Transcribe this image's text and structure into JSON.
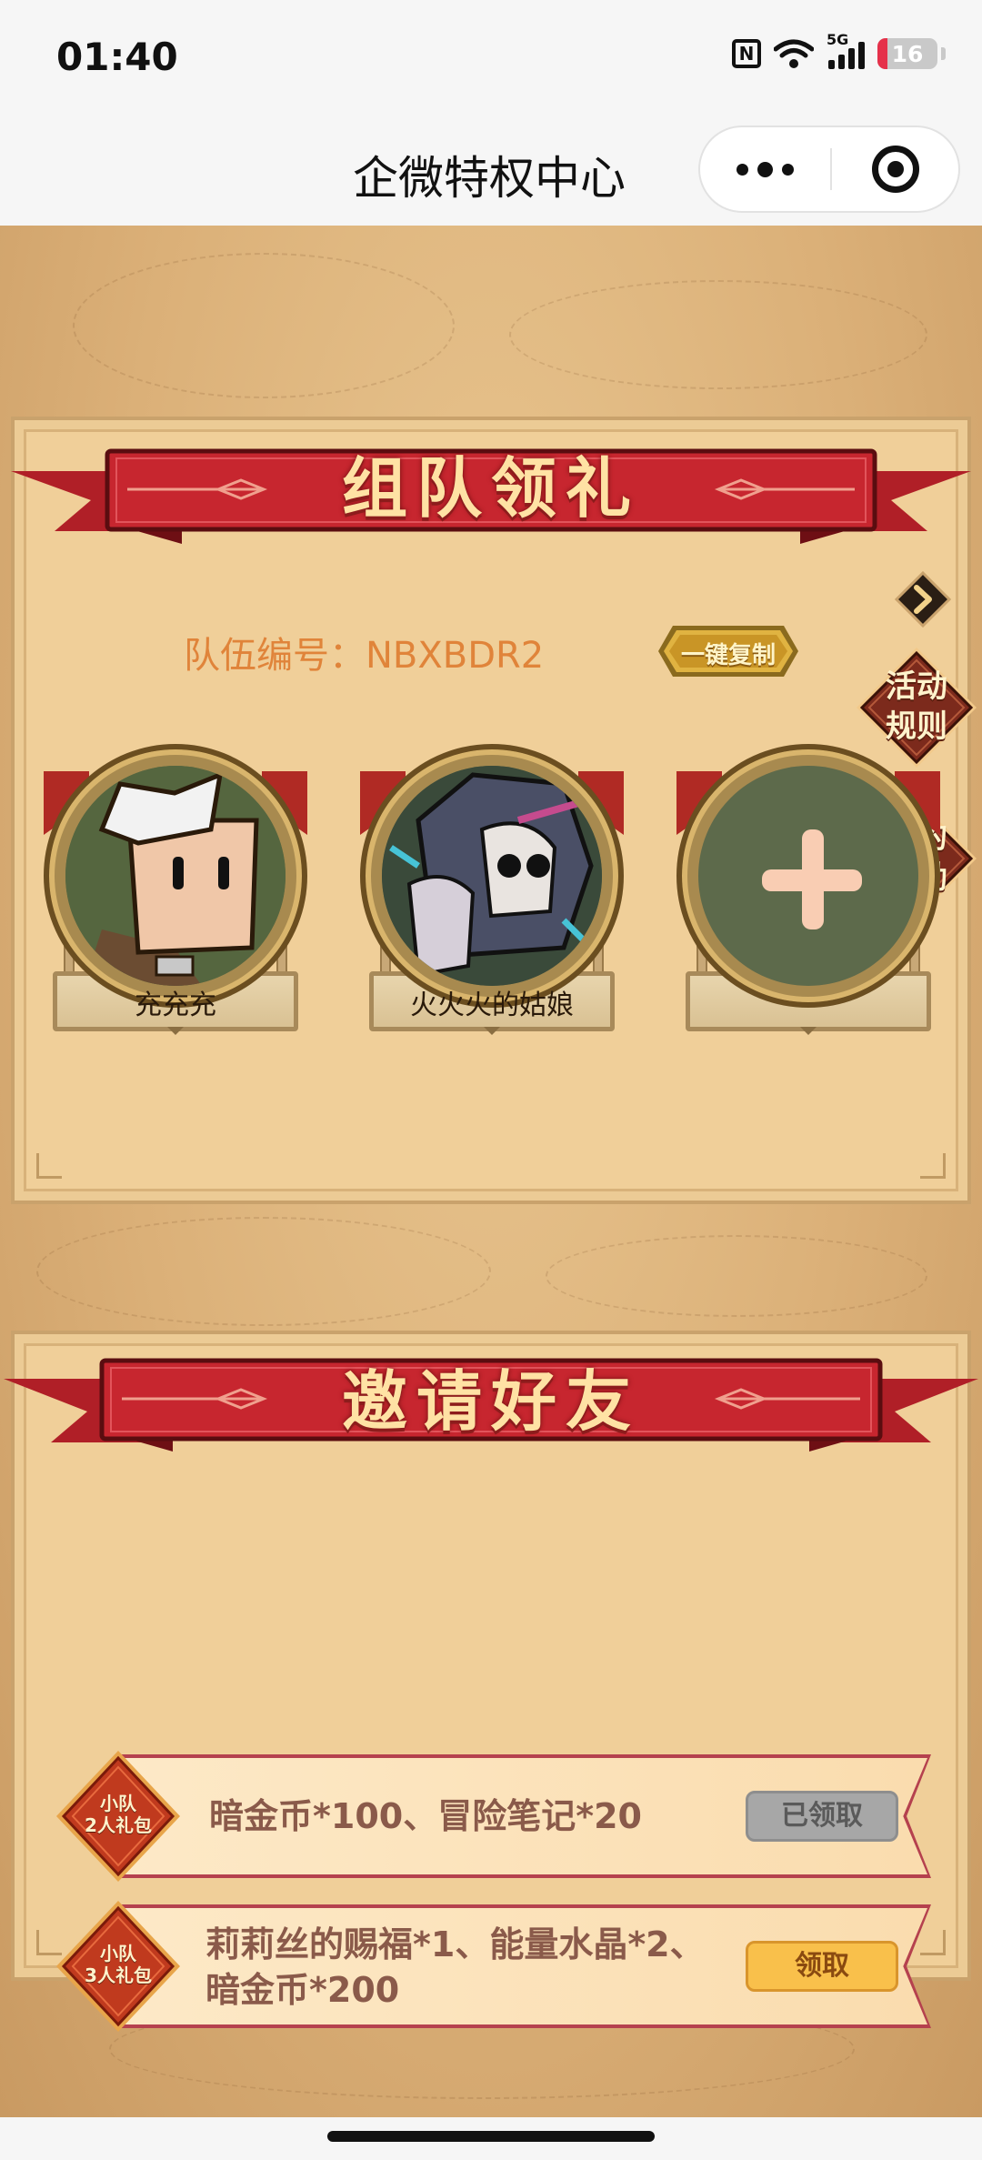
{
  "status_bar": {
    "time": "01:40",
    "network": "5G",
    "battery": "16",
    "battery_fraction": 0.16,
    "icons": [
      "nfc-icon",
      "wifi-icon",
      "signal-icon",
      "battery-icon"
    ]
  },
  "nav": {
    "title": "企微特权中心",
    "more_icon": "more-dots-icon",
    "close_icon": "close-miniprogram-icon"
  },
  "team": {
    "section_title": "组队领礼",
    "team_id_label": "队伍编号：NBXBDR2",
    "copy_label": "一键复制",
    "rules_label": [
      "活动",
      "规则"
    ],
    "rewards_label": [
      "我的",
      "奖励"
    ],
    "members": [
      {
        "name": "充充充"
      },
      {
        "name": "火火火的姑娘"
      },
      {
        "name": ""
      }
    ]
  },
  "invite": {
    "section_title": "邀请好友",
    "rewards": [
      {
        "badge": [
          "小队",
          "2人礼包"
        ],
        "desc": [
          "暗金币*100、冒险笔记*20"
        ],
        "button": "已领取",
        "state": "claimed"
      },
      {
        "badge": [
          "小队",
          "3人礼包"
        ],
        "desc": [
          "莉莉丝的赐福*1、能量水晶*2、",
          "暗金币*200"
        ],
        "button": "领取",
        "state": "available"
      }
    ]
  },
  "colors": {
    "ribbon_red": "#c7262f",
    "parchment": "#f0cf99",
    "team_id_orange": "#e0843a",
    "claim_yellow": "#f9c04b",
    "claimed_gray": "#a7a7a7"
  }
}
